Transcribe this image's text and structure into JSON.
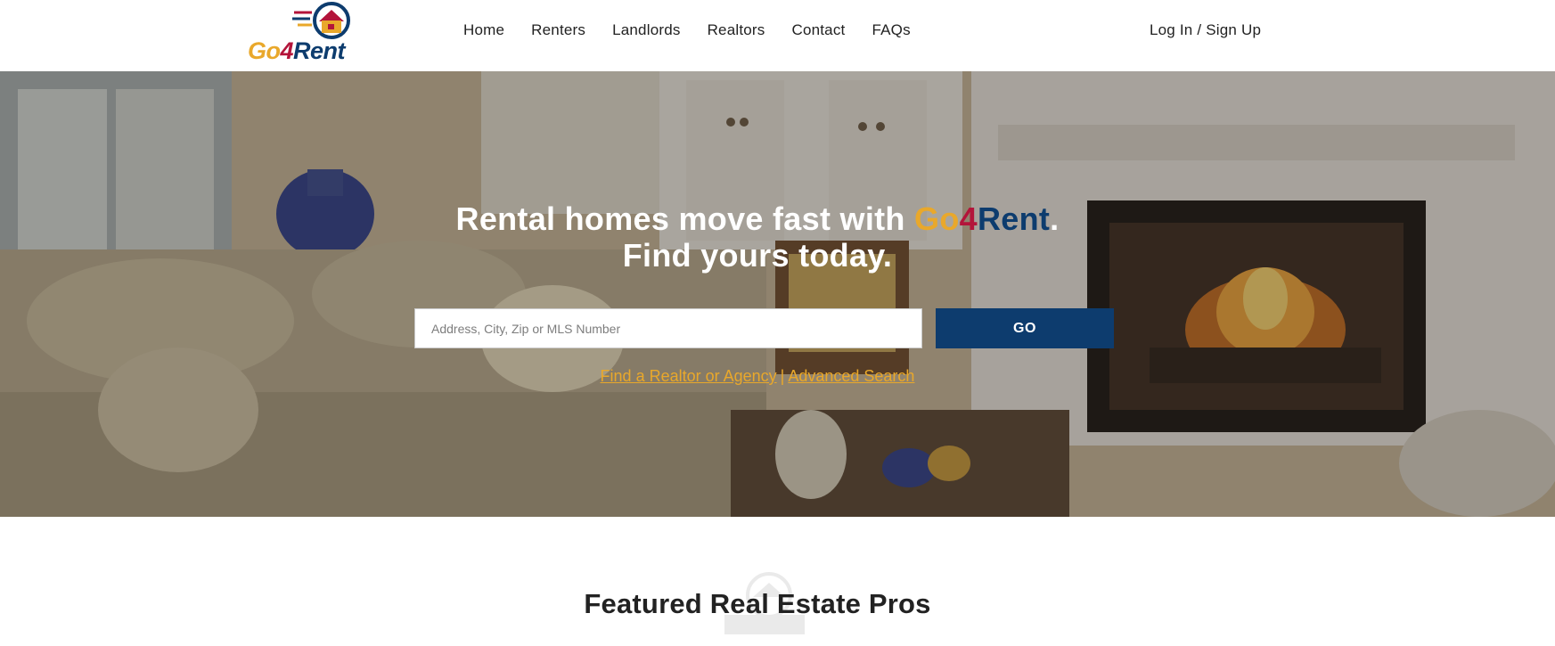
{
  "header": {
    "logo": {
      "text_go": "Go",
      "text_four": "4",
      "text_rent": "Rent"
    },
    "nav": [
      {
        "label": "Home"
      },
      {
        "label": "Renters"
      },
      {
        "label": "Landlords"
      },
      {
        "label": "Realtors"
      },
      {
        "label": "Contact"
      },
      {
        "label": "FAQs"
      }
    ],
    "login_label": "Log In / Sign Up"
  },
  "hero": {
    "headline_part1": "Rental homes move fast with ",
    "brand_go": "Go",
    "brand_four": "4",
    "brand_rent": "Rent",
    "headline_period": ".",
    "headline_line2": "Find yours today.",
    "search": {
      "placeholder": "Address, City, Zip or MLS Number",
      "value": ""
    },
    "go_label": "GO",
    "link_realtor": "Find a Realtor or Agency",
    "link_separator": "|",
    "link_advanced": "Advanced Search"
  },
  "featured": {
    "title": "Featured Real Estate Pros"
  },
  "colors": {
    "brand_yellow": "#e9a82b",
    "brand_red": "#b3143a",
    "brand_navy": "#0d3c6e"
  }
}
